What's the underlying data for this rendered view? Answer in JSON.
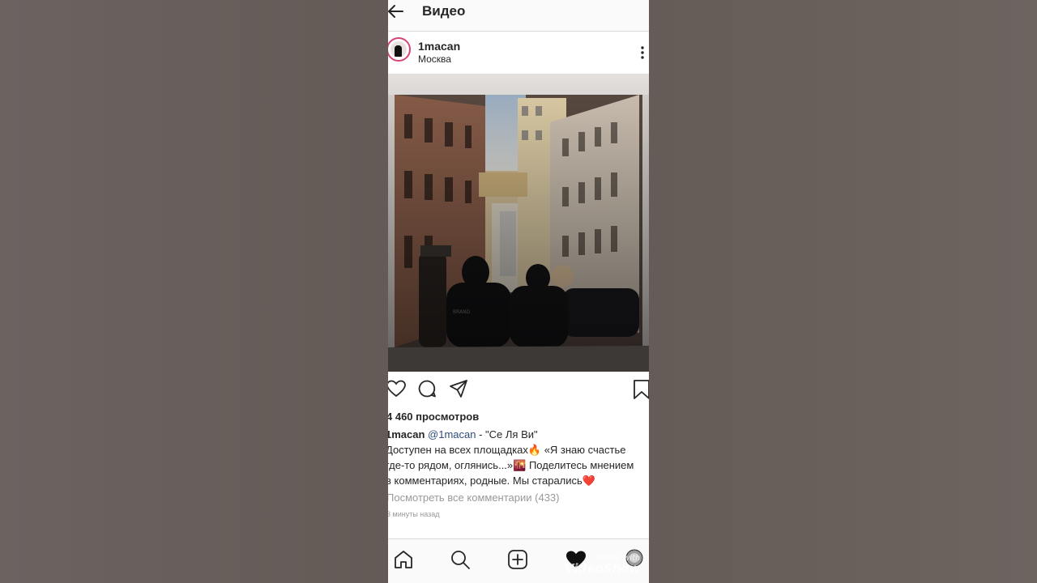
{
  "appbar": {
    "title": "Видео"
  },
  "post": {
    "username": "1macan",
    "location": "Москва",
    "views": "4 460 просмотров",
    "caption": {
      "user": "1macan",
      "mention": "@1macan",
      "title": " - \"Се Ля Ви\"",
      "line2": "Доступен на всех площадках🔥 «Я знаю счастье",
      "line3": "где-то рядом, оглянись...»🌇 Поделитесь мнением",
      "line4": "в комментариях, родные. Мы старались❤️"
    },
    "comments_link": "Посмотреть все комментарии (433)",
    "time_ago": "3 минуты назад"
  },
  "watermark": {
    "line1": "Made with",
    "line2": "VideoShow"
  },
  "icons": {
    "back": "back-arrow-icon",
    "more": "more-vertical-icon",
    "like": "heart-outline-icon",
    "comment": "comment-bubble-icon",
    "share": "paper-plane-icon",
    "save": "bookmark-icon",
    "home": "home-icon",
    "search": "search-icon",
    "add": "add-post-icon",
    "activity": "heart-filled-icon",
    "profile": "profile-avatar-icon"
  },
  "colors": {
    "accent_ring": "#d9437a",
    "mention": "#2f4b7c",
    "muted": "#999999"
  }
}
